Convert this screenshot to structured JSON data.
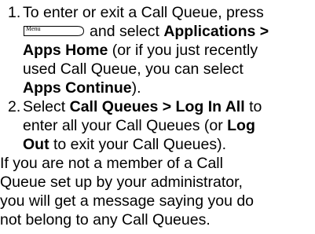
{
  "steps": [
    {
      "number": "1.",
      "l1": "To enter or exit a Call Queue, press",
      "key_label": "Menu",
      "l2_text": "and select ",
      "l2_bold": "Applications >",
      "l3_bold": "Apps Home",
      "l3_text": " (or if you just recently",
      "l4": "used Call Queue, you can select",
      "l5_bold": "Apps Continue",
      "l5_text": ")."
    },
    {
      "number": "2.",
      "l1_text": "Select ",
      "l1_bold": "Call Queues > Log In All",
      "l1_text2": " to",
      "l2_text": "enter all your Call Queues (or ",
      "l2_bold": "Log",
      "l3_bold": "Out",
      "l3_text": " to exit your Call Queues)."
    }
  ],
  "note": [
    "If you are not a member of a Call",
    "Queue set up by your administrator,",
    "you will get a message saying you do",
    "not belong to any Call Queues."
  ]
}
